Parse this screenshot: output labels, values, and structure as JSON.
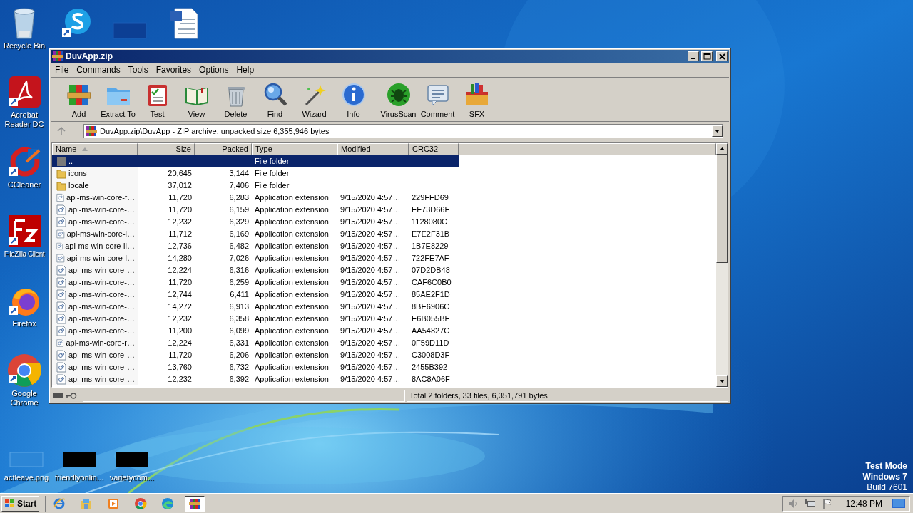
{
  "desktop_icons": [
    {
      "label": "Recycle Bin",
      "kind": "recycle-bin"
    },
    {
      "kind": "skype"
    },
    {
      "kind": "thumb-blue"
    },
    {
      "kind": "word-doc"
    },
    {
      "label": "Acrobat Reader DC",
      "kind": "acrobat"
    },
    {
      "label": "CCleaner",
      "kind": "ccleaner"
    },
    {
      "label": "FileZilla Client",
      "kind": "filezilla"
    },
    {
      "label": "Firefox",
      "kind": "firefox"
    },
    {
      "label": "Google Chrome",
      "kind": "chrome"
    },
    {
      "label": "actleave.png",
      "kind": "thumb-faint"
    },
    {
      "label": "friendlyonlin...",
      "kind": "thumb-black"
    },
    {
      "label": "varietycom...",
      "kind": "thumb-black"
    }
  ],
  "window": {
    "title": "DuvApp.zip",
    "menu": [
      "File",
      "Commands",
      "Tools",
      "Favorites",
      "Options",
      "Help"
    ],
    "toolbar": [
      {
        "label": "Add",
        "kind": "add"
      },
      {
        "label": "Extract To",
        "kind": "extract"
      },
      {
        "label": "Test",
        "kind": "test"
      },
      {
        "label": "View",
        "kind": "view"
      },
      {
        "label": "Delete",
        "kind": "delete"
      },
      {
        "label": "Find",
        "kind": "find"
      },
      {
        "label": "Wizard",
        "kind": "wizard"
      },
      {
        "label": "Info",
        "kind": "info"
      },
      {
        "label": "VirusScan",
        "kind": "virus"
      },
      {
        "label": "Comment",
        "kind": "comment"
      },
      {
        "label": "SFX",
        "kind": "sfx"
      }
    ],
    "address": "DuvApp.zip\\DuvApp - ZIP archive, unpacked size 6,355,946 bytes",
    "columns": [
      {
        "label": "Name",
        "sorted": true
      },
      {
        "label": "Size",
        "sorted": false
      },
      {
        "label": "Packed",
        "sorted": false
      },
      {
        "label": "Type",
        "sorted": false
      },
      {
        "label": "Modified",
        "sorted": false
      },
      {
        "label": "CRC32",
        "sorted": false
      }
    ],
    "rows": [
      {
        "kind": "parent",
        "name": "..",
        "type": "File folder",
        "selected": true
      },
      {
        "kind": "folder",
        "name": "icons",
        "size": "20,645",
        "packed": "3,144",
        "type": "File folder",
        "selected": false
      },
      {
        "kind": "folder",
        "name": "locale",
        "size": "37,012",
        "packed": "7,406",
        "type": "File folder",
        "selected": false
      },
      {
        "kind": "file",
        "name": "api-ms-win-core-f…",
        "size": "11,720",
        "packed": "6,283",
        "type": "Application extension",
        "modified": "9/15/2020 4:57…",
        "crc32": "229FFD69",
        "selected": false
      },
      {
        "kind": "file",
        "name": "api-ms-win-core-…",
        "size": "11,720",
        "packed": "6,159",
        "type": "Application extension",
        "modified": "9/15/2020 4:57…",
        "crc32": "EF73D66F",
        "selected": false
      },
      {
        "kind": "file",
        "name": "api-ms-win-core-…",
        "size": "12,232",
        "packed": "6,329",
        "type": "Application extension",
        "modified": "9/15/2020 4:57…",
        "crc32": "1128080C",
        "selected": false
      },
      {
        "kind": "file",
        "name": "api-ms-win-core-i…",
        "size": "11,712",
        "packed": "6,169",
        "type": "Application extension",
        "modified": "9/15/2020 4:57…",
        "crc32": "E7E2F31B",
        "selected": false
      },
      {
        "kind": "file",
        "name": "api-ms-win-core-li…",
        "size": "12,736",
        "packed": "6,482",
        "type": "Application extension",
        "modified": "9/15/2020 4:57…",
        "crc32": "1B7E8229",
        "selected": false
      },
      {
        "kind": "file",
        "name": "api-ms-win-core-l…",
        "size": "14,280",
        "packed": "7,026",
        "type": "Application extension",
        "modified": "9/15/2020 4:57…",
        "crc32": "722FE7AF",
        "selected": false
      },
      {
        "kind": "file",
        "name": "api-ms-win-core-…",
        "size": "12,224",
        "packed": "6,316",
        "type": "Application extension",
        "modified": "9/15/2020 4:57…",
        "crc32": "07D2DB48",
        "selected": false
      },
      {
        "kind": "file",
        "name": "api-ms-win-core-…",
        "size": "11,720",
        "packed": "6,259",
        "type": "Application extension",
        "modified": "9/15/2020 4:57…",
        "crc32": "CAF6C0B0",
        "selected": false
      },
      {
        "kind": "file",
        "name": "api-ms-win-core-…",
        "size": "12,744",
        "packed": "6,411",
        "type": "Application extension",
        "modified": "9/15/2020 4:57…",
        "crc32": "85AE2F1D",
        "selected": false
      },
      {
        "kind": "file",
        "name": "api-ms-win-core-…",
        "size": "14,272",
        "packed": "6,913",
        "type": "Application extension",
        "modified": "9/15/2020 4:57…",
        "crc32": "8BE6906C",
        "selected": false
      },
      {
        "kind": "file",
        "name": "api-ms-win-core-…",
        "size": "12,232",
        "packed": "6,358",
        "type": "Application extension",
        "modified": "9/15/2020 4:57…",
        "crc32": "E6B055BF",
        "selected": false
      },
      {
        "kind": "file",
        "name": "api-ms-win-core-…",
        "size": "11,200",
        "packed": "6,099",
        "type": "Application extension",
        "modified": "9/15/2020 4:57…",
        "crc32": "AA54827C",
        "selected": false
      },
      {
        "kind": "file",
        "name": "api-ms-win-core-r…",
        "size": "12,224",
        "packed": "6,331",
        "type": "Application extension",
        "modified": "9/15/2020 4:57…",
        "crc32": "0F59D11D",
        "selected": false
      },
      {
        "kind": "file",
        "name": "api-ms-win-core-…",
        "size": "11,720",
        "packed": "6,206",
        "type": "Application extension",
        "modified": "9/15/2020 4:57…",
        "crc32": "C3008D3F",
        "selected": false
      },
      {
        "kind": "file",
        "name": "api-ms-win-core-…",
        "size": "13,760",
        "packed": "6,732",
        "type": "Application extension",
        "modified": "9/15/2020 4:57…",
        "crc32": "2455B392",
        "selected": false
      },
      {
        "kind": "file",
        "name": "api-ms-win-core-…",
        "size": "12,232",
        "packed": "6,392",
        "type": "Application extension",
        "modified": "9/15/2020 4:57…",
        "crc32": "8AC8A06F",
        "selected": false
      }
    ],
    "status": "Total 2 folders, 33 files, 6,351,791 bytes"
  },
  "test_mode": [
    "Test Mode",
    "Windows 7",
    "Build 7601"
  ],
  "taskbar": {
    "start": "Start",
    "apps": [
      {
        "kind": "ie",
        "active": false
      },
      {
        "kind": "explorer",
        "active": false
      },
      {
        "kind": "media",
        "active": false
      },
      {
        "kind": "chrome",
        "active": false
      },
      {
        "kind": "edge",
        "active": false
      },
      {
        "kind": "winrar",
        "active": true
      }
    ],
    "clock": "12:48 PM"
  }
}
